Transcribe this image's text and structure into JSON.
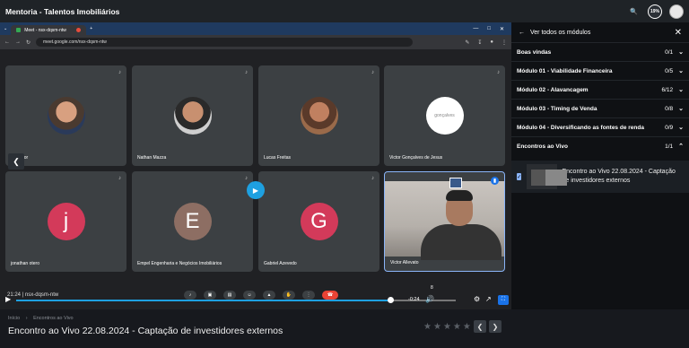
{
  "app": {
    "title": "Mentoria - Talentos Imobiliários",
    "progress_badge": "19%",
    "accent_color": "#1ea0e0"
  },
  "browser": {
    "tab_title": "Meet - nsx-dqsm-ntw",
    "url": "meet.google.com/nsx-dqsm-ntw"
  },
  "meet": {
    "participants": [
      {
        "name": "m Júnior",
        "type": "photo"
      },
      {
        "name": "Nathan Mazza",
        "type": "photo"
      },
      {
        "name": "Lucas Freitas",
        "type": "photo"
      },
      {
        "name": "Victor Gonçalves de Jesus",
        "type": "logo",
        "logo_text": "gonçalves"
      },
      {
        "name": "jonathan otero",
        "type": "initial",
        "initial": "j",
        "color": "#d33a5a"
      },
      {
        "name": "Empel Engenharia e Negócios Imobiliários",
        "type": "initial",
        "initial": "E",
        "color": "#8d6e63"
      },
      {
        "name": "Gabriel Azevedo",
        "type": "initial",
        "initial": "G",
        "color": "#d33a5a"
      },
      {
        "name": "Victor Allevato",
        "type": "camera"
      }
    ],
    "meeting_time": "21:24",
    "meeting_code": "nsx-dqsm-ntw",
    "self_count": "8"
  },
  "video": {
    "time_remaining": "-0:24",
    "progress": 0.84
  },
  "sidebar": {
    "back_label": "Ver todos os módulos",
    "modules": [
      {
        "label": "Boas vindas",
        "count": "0/1",
        "chevron": "down"
      },
      {
        "label": "Módulo 01 - Viabilidade Financeira",
        "count": "0/5",
        "chevron": "down"
      },
      {
        "label": "Módulo 02 - Alavancagem",
        "count": "6/12",
        "chevron": "down"
      },
      {
        "label": "Módulo 03 - Timing de Venda",
        "count": "0/8",
        "chevron": "down"
      },
      {
        "label": "Módulo 04 - Diversificando as fontes de renda",
        "count": "0/9",
        "chevron": "down"
      },
      {
        "label": "Encontros ao Vivo",
        "count": "1/1",
        "chevron": "up"
      }
    ],
    "lesson": {
      "title": "Encontro ao Vivo 22.08.2024 - Captação de investidores externos",
      "completed": true
    }
  },
  "footer": {
    "breadcrumb": [
      "Início",
      "Encontros ao Vivo"
    ],
    "title": "Encontro ao Vivo 22.08.2024 - Captação de investidores externos",
    "rating": 0,
    "rating_max": 5
  }
}
